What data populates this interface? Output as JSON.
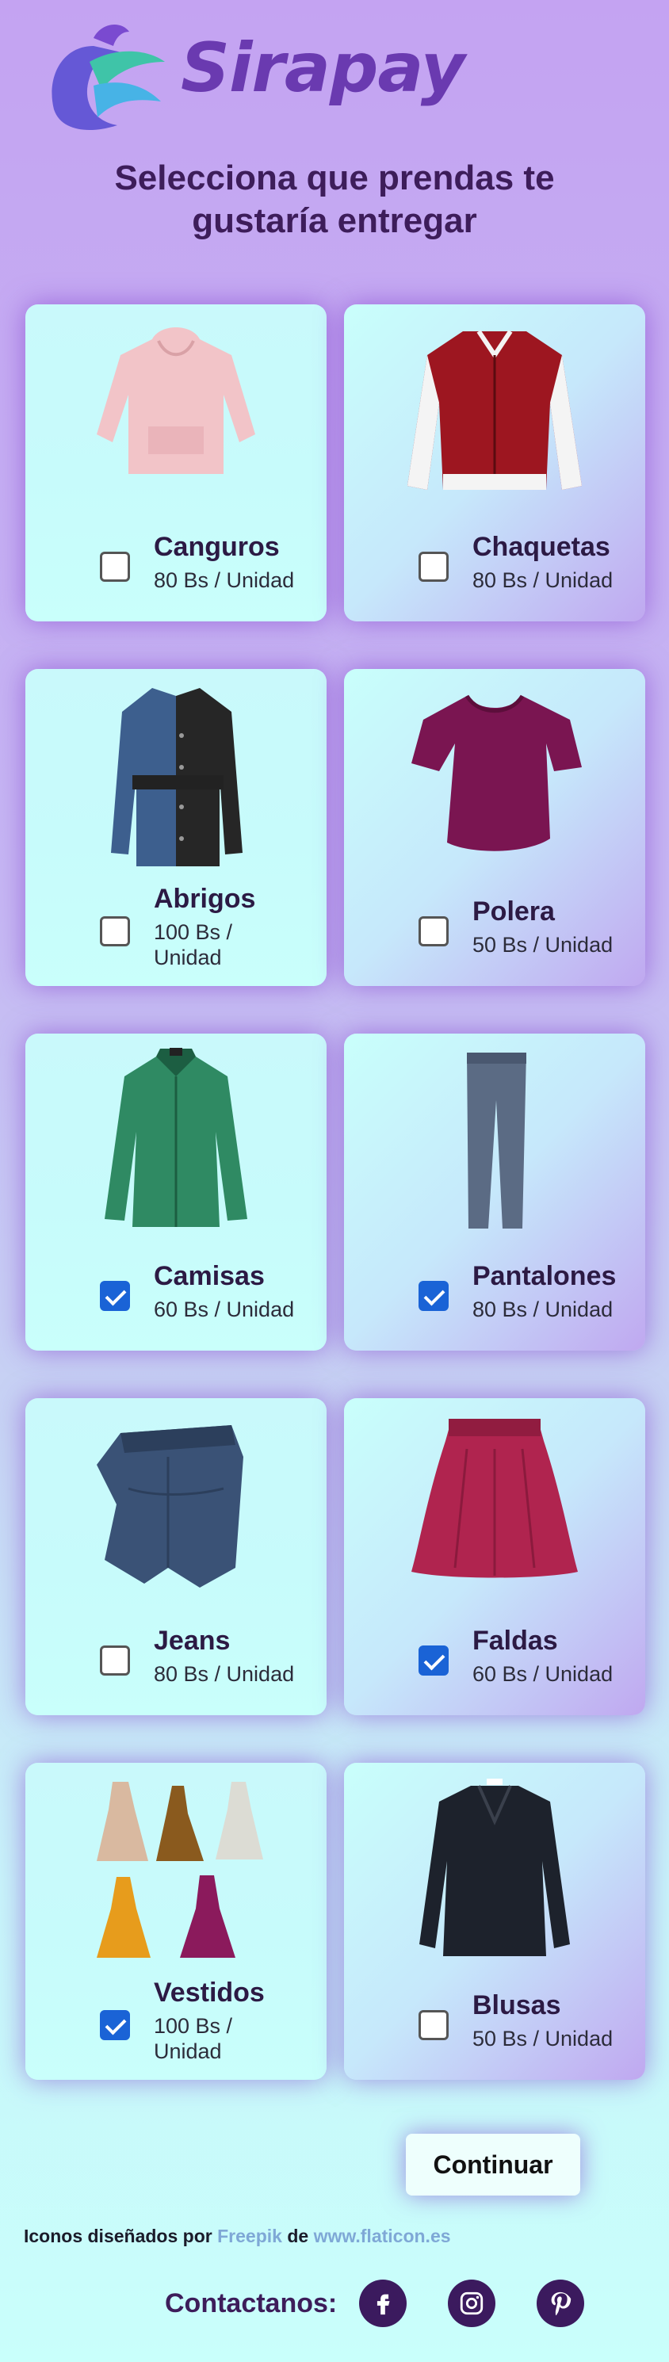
{
  "brand": {
    "name": "Sirapay"
  },
  "headline": {
    "line1": "Selecciona que prendas te",
    "line2": "gustaría entregar"
  },
  "items": [
    {
      "name": "Canguros",
      "price": "80 Bs / Unidad",
      "checked": false,
      "icon": "hoodie-icon"
    },
    {
      "name": "Chaquetas",
      "price": "80 Bs / Unidad",
      "checked": false,
      "icon": "jacket-icon"
    },
    {
      "name": "Abrigos",
      "price": "100 Bs / Unidad",
      "checked": false,
      "icon": "coat-icon"
    },
    {
      "name": "Polera",
      "price": "50 Bs / Unidad",
      "checked": false,
      "icon": "tshirt-icon"
    },
    {
      "name": "Camisas",
      "price": "60 Bs / Unidad",
      "checked": true,
      "icon": "shirt-icon"
    },
    {
      "name": "Pantalones",
      "price": "80 Bs / Unidad",
      "checked": true,
      "icon": "pants-icon"
    },
    {
      "name": "Jeans",
      "price": "80 Bs / Unidad",
      "checked": false,
      "icon": "jeans-icon"
    },
    {
      "name": "Faldas",
      "price": "60 Bs / Unidad",
      "checked": true,
      "icon": "skirt-icon"
    },
    {
      "name": "Vestidos",
      "price": "100 Bs / Unidad",
      "checked": true,
      "icon": "dresses-icon"
    },
    {
      "name": "Blusas",
      "price": "50 Bs / Unidad",
      "checked": false,
      "icon": "blouse-icon"
    }
  ],
  "actions": {
    "continue_label": "Continuar"
  },
  "credits": {
    "prefix": "Iconos diseñados por",
    "author": "Freepik",
    "middle": "de",
    "site": "www.flaticon.es"
  },
  "contact": {
    "label": "Contactanos:"
  },
  "colors": {
    "accent": "#6a3ab0",
    "check": "#1a63d6",
    "social": "#3b1a5e"
  }
}
